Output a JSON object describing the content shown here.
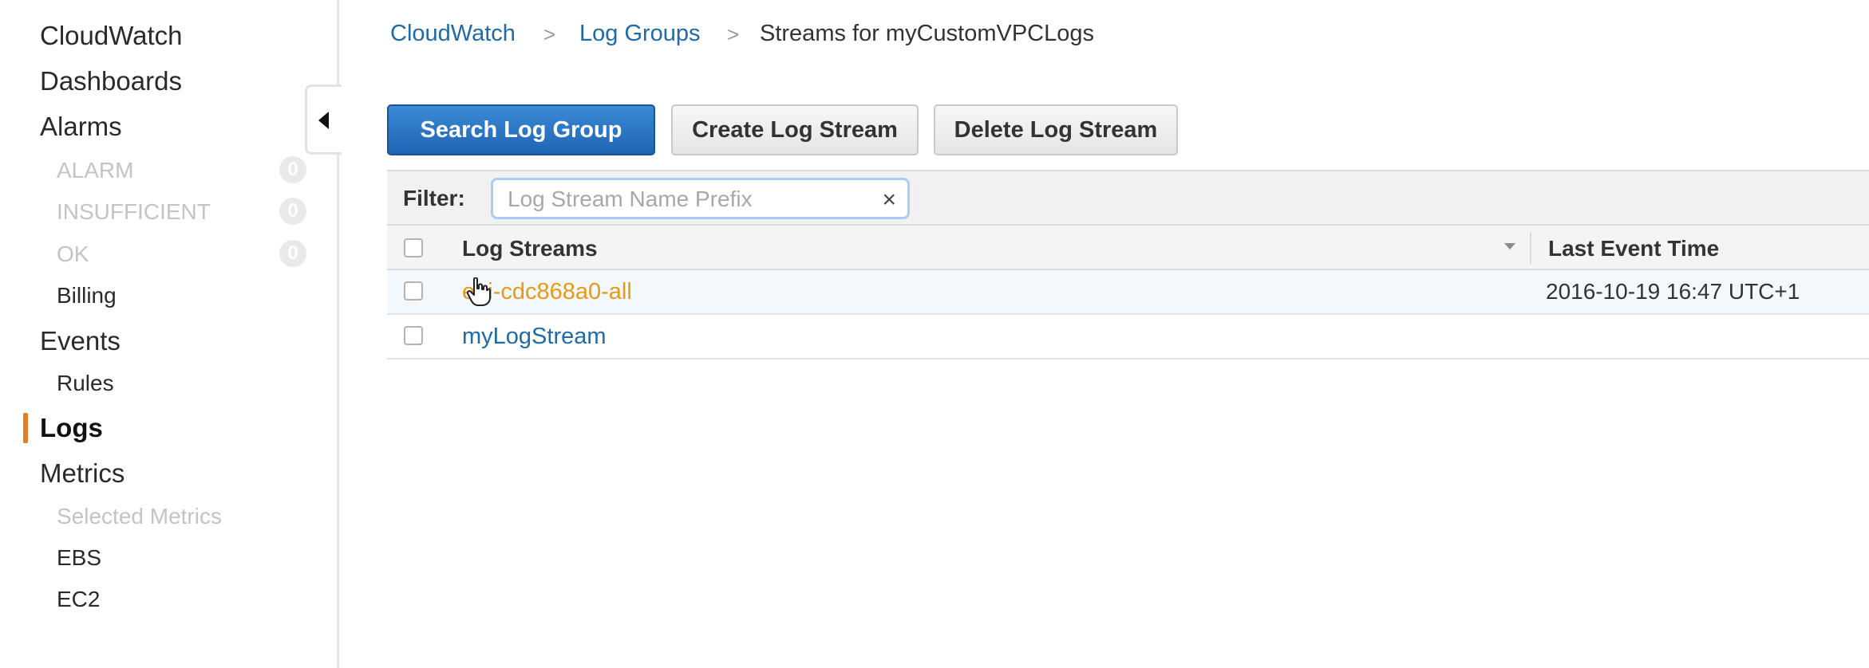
{
  "sidebar": {
    "items": [
      {
        "label": "CloudWatch"
      },
      {
        "label": "Dashboards"
      },
      {
        "label": "Alarms"
      },
      {
        "label": "ALARM",
        "count": "0"
      },
      {
        "label": "INSUFFICIENT",
        "count": "0"
      },
      {
        "label": "OK",
        "count": "0"
      },
      {
        "label": "Billing"
      },
      {
        "label": "Events"
      },
      {
        "label": "Rules"
      },
      {
        "label": "Logs"
      },
      {
        "label": "Metrics"
      },
      {
        "label": "Selected Metrics"
      },
      {
        "label": "EBS"
      },
      {
        "label": "EC2"
      }
    ],
    "active_item": "Logs",
    "accent_color": "#e77b22"
  },
  "breadcrumb": {
    "items": [
      {
        "label": "CloudWatch"
      },
      {
        "label": "Log Groups"
      },
      {
        "label": "Streams for myCustomVPCLogs"
      }
    ],
    "separator": ">"
  },
  "toolbar": {
    "search_label": "Search Log Group",
    "create_label": "Create Log Stream",
    "delete_label": "Delete Log Stream"
  },
  "filter": {
    "label": "Filter:",
    "placeholder": "Log Stream Name Prefix",
    "value": "",
    "clear_symbol": "×"
  },
  "table": {
    "columns": [
      "Log Streams",
      "Last Event Time"
    ],
    "rows": [
      {
        "name": "eni-cdc868a0-all",
        "last_event": "2016-10-19 16:47 UTC+1",
        "hovered": true
      },
      {
        "name": "myLogStream",
        "last_event": "",
        "hovered": false
      }
    ]
  },
  "icons": {
    "collapse": "caret-left-icon",
    "sort": "sort-down-icon",
    "cursor": "hand-pointer-icon"
  }
}
